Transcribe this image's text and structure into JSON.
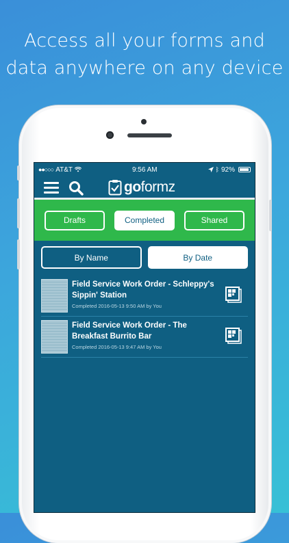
{
  "headline": {
    "line1": "Access all your forms and",
    "line2": "data anywhere on any device"
  },
  "statusbar": {
    "carrier": "AT&T",
    "time": "9:56 AM",
    "battery": "92%"
  },
  "navbar": {
    "logo_go": "go",
    "logo_formz": "formz"
  },
  "tabs": [
    {
      "label": "Drafts",
      "active": false
    },
    {
      "label": "Completed",
      "active": true
    },
    {
      "label": "Shared",
      "active": false
    }
  ],
  "sort": [
    {
      "label": "By Name",
      "active": false
    },
    {
      "label": "By Date",
      "active": true
    }
  ],
  "items": [
    {
      "title": "Field Service Work Order - Schleppy's Sippin' Station",
      "meta": "Completed 2016-05-13 9:50 AM by You"
    },
    {
      "title": "Field Service Work Order - The Breakfast Burrito Bar",
      "meta": "Completed 2016-05-13 9:47 AM by You"
    }
  ],
  "colors": {
    "screen_bg": "#0f5f82",
    "tab_bar": "#2fb84b",
    "accent": "#ffffff"
  },
  "icons": {
    "menu": "hamburger-icon",
    "search": "search-icon",
    "logo": "clipboard-check-icon",
    "form": "form-grid-icon"
  }
}
